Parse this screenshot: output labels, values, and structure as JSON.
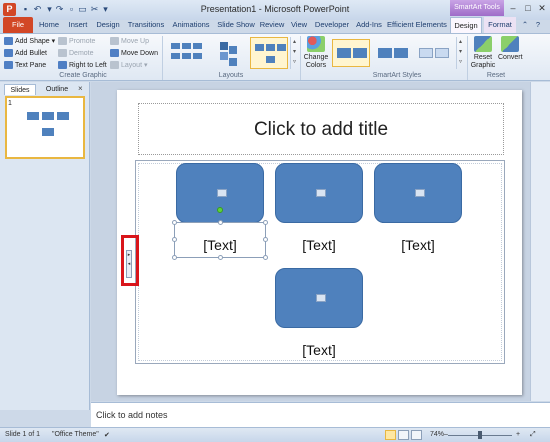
{
  "window": {
    "title": "Presentation1 - Microsoft PowerPoint",
    "contextual_group": "SmartArt Tools",
    "app_icon": "P"
  },
  "tabs": [
    {
      "label": "File"
    },
    {
      "label": "Home"
    },
    {
      "label": "Insert"
    },
    {
      "label": "Design"
    },
    {
      "label": "Transitions"
    },
    {
      "label": "Animations"
    },
    {
      "label": "Slide Show"
    },
    {
      "label": "Review"
    },
    {
      "label": "View"
    },
    {
      "label": "Developer"
    },
    {
      "label": "Add-Ins"
    },
    {
      "label": "Efficient Elements"
    },
    {
      "label": "Design"
    },
    {
      "label": "Format"
    }
  ],
  "ribbon": {
    "create_graphic": {
      "add_shape": "Add Shape",
      "add_bullet": "Add Bullet",
      "text_pane": "Text Pane",
      "promote": "Promote",
      "demote": "Demote",
      "right_to_left": "Right to Left",
      "move_up": "Move Up",
      "move_down": "Move Down",
      "layout": "Layout",
      "label": "Create Graphic"
    },
    "layouts": {
      "label": "Layouts"
    },
    "smartart_styles": {
      "change_colors": "Change Colors",
      "label": "SmartArt Styles"
    },
    "reset": {
      "reset_graphic": "Reset Graphic",
      "convert": "Convert",
      "label": "Reset"
    }
  },
  "slides_pane": {
    "tab_slides": "Slides",
    "tab_outline": "Outline",
    "close": "×",
    "slide_number": "1"
  },
  "slide": {
    "title_placeholder": "Click to add title",
    "smartart_texts": [
      "[Text]",
      "[Text]",
      "[Text]",
      "[Text]"
    ]
  },
  "notes": {
    "placeholder": "Click to add notes"
  },
  "status": {
    "slide_info": "Slide 1 of 1",
    "theme": "\"Office Theme\"",
    "zoom": "74%"
  },
  "colors": {
    "accent_shape": "#4f81bd",
    "file_tab": "#d24726",
    "highlight": "#e9b741",
    "callout": "#d9151b"
  }
}
